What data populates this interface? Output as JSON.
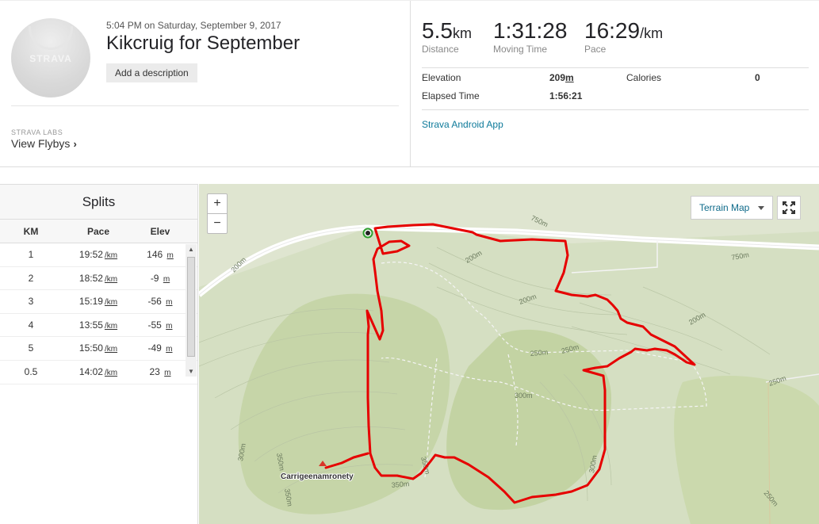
{
  "activity": {
    "timestamp": "5:04 PM on Saturday, September 9, 2017",
    "title": "Kikcruig for September",
    "add_description": "Add a description",
    "avatar_brand": "STRAVA"
  },
  "labs": {
    "label": "STRAVA LABS",
    "flyby_link": "View Flybys",
    "flyby_chevron": "›"
  },
  "stats": {
    "distance": {
      "value": "5.5",
      "unit": "km",
      "label": "Distance"
    },
    "moving_time": {
      "value": "1:31:28",
      "label": "Moving Time"
    },
    "pace": {
      "value": "16:29",
      "unit": "/km",
      "label": "Pace"
    },
    "elevation": {
      "label": "Elevation",
      "value": "209",
      "unit": "m"
    },
    "calories": {
      "label": "Calories",
      "value": "0"
    },
    "elapsed": {
      "label": "Elapsed Time",
      "value": "1:56:21"
    },
    "app": "Strava Android App"
  },
  "splits": {
    "title": "Splits",
    "columns": [
      "KM",
      "Pace",
      "Elev"
    ],
    "pace_unit": "/km",
    "elev_unit": "m",
    "rows": [
      {
        "km": "1",
        "pace": "19:52",
        "elev": "146"
      },
      {
        "km": "2",
        "pace": "18:52",
        "elev": "-9"
      },
      {
        "km": "3",
        "pace": "15:19",
        "elev": "-56"
      },
      {
        "km": "4",
        "pace": "13:55",
        "elev": "-55"
      },
      {
        "km": "5",
        "pace": "15:50",
        "elev": "-49"
      },
      {
        "km": "0.5",
        "pace": "14:02",
        "elev": "23"
      }
    ]
  },
  "map": {
    "zoom_in": "+",
    "zoom_out": "−",
    "map_type": "Terrain Map",
    "place_label": "Carrigeenamronety",
    "contours": [
      "750m",
      "750m",
      "200m",
      "200m",
      "200m",
      "200m",
      "250m",
      "250m",
      "250m",
      "300m",
      "300m",
      "300m",
      "350m",
      "350m",
      "350m",
      "350m",
      "250m",
      "250m"
    ],
    "route_color": "#e60000"
  }
}
